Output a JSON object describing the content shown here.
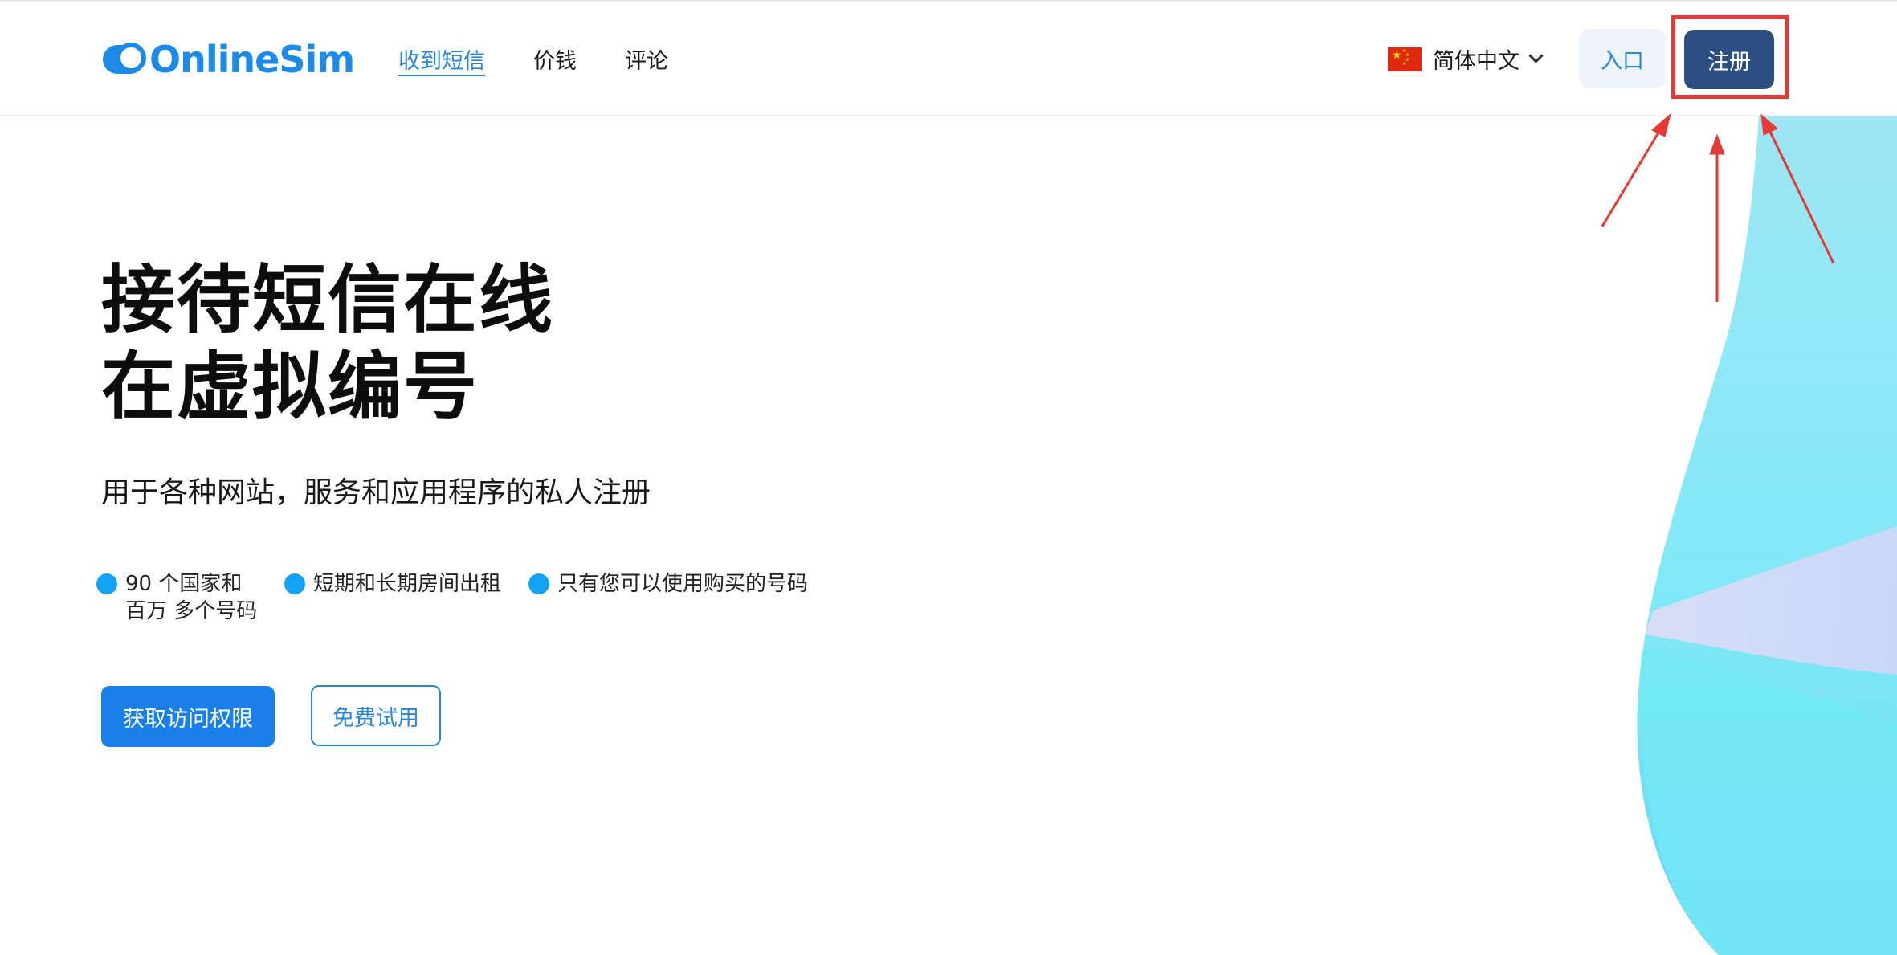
{
  "header": {
    "logo_text": "OnlineSim",
    "nav": [
      {
        "label": "收到短信",
        "active": true
      },
      {
        "label": "价钱",
        "active": false
      },
      {
        "label": "评论",
        "active": false
      }
    ],
    "language": {
      "label": "简体中文",
      "flag": "cn-flag"
    },
    "login_label": "入口",
    "register_label": "注册"
  },
  "hero": {
    "title_line1": "接待短信在线",
    "title_line2": "在虚拟编号",
    "subtitle": "用于各种网站，服务和应用程序的私人注册",
    "features": [
      {
        "line1": "90 个国家和",
        "line2": "百万 多个号码"
      },
      {
        "line1": "短期和长期房间出租"
      },
      {
        "line1": "只有您可以使用购买的号码"
      }
    ],
    "primary_button": "获取访问权限",
    "secondary_button": "免费试用"
  },
  "colors": {
    "brand": "#1c8ae6",
    "register_bg": "#2d4e80",
    "primary_button": "#1a7fe8",
    "feature_dot": "#14a2f2",
    "annotation_red": "#e53935"
  }
}
